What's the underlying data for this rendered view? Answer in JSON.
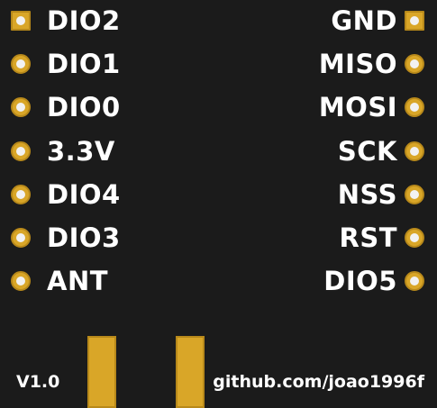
{
  "colors": {
    "board": "#1b1b1b",
    "pad": "#d9a628",
    "pad_edge": "#b8891a",
    "hole": "#f2f2f2",
    "text": "#ffffff"
  },
  "left_pins": [
    {
      "label": "DIO2",
      "shape": "square"
    },
    {
      "label": "DIO1",
      "shape": "round"
    },
    {
      "label": "DIO0",
      "shape": "round"
    },
    {
      "label": "3.3V",
      "shape": "round"
    },
    {
      "label": "DIO4",
      "shape": "round"
    },
    {
      "label": "DIO3",
      "shape": "round"
    },
    {
      "label": "ANT",
      "shape": "round"
    }
  ],
  "right_pins": [
    {
      "label": "GND",
      "shape": "square"
    },
    {
      "label": "MISO",
      "shape": "round"
    },
    {
      "label": "MOSI",
      "shape": "round"
    },
    {
      "label": "SCK",
      "shape": "round"
    },
    {
      "label": "NSS",
      "shape": "round"
    },
    {
      "label": "RST",
      "shape": "round"
    },
    {
      "label": "DIO5",
      "shape": "round"
    }
  ],
  "footer": {
    "version": "V1.0",
    "url": "github.com/joao1996f"
  }
}
